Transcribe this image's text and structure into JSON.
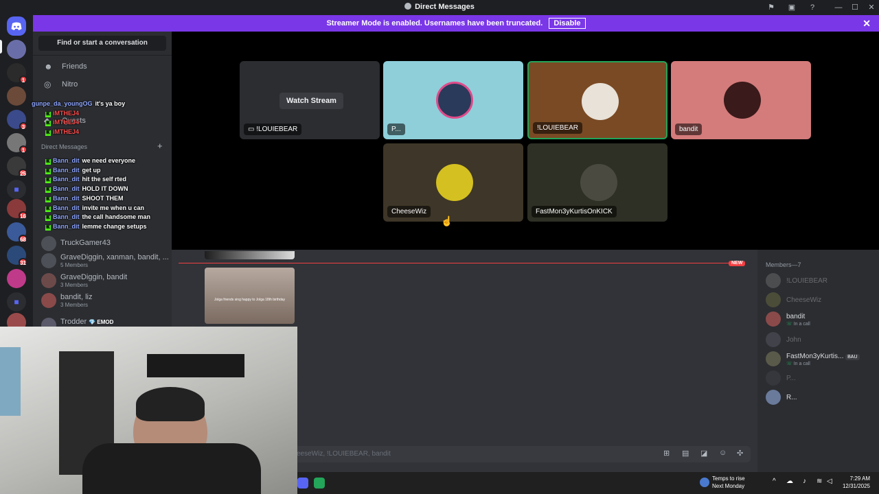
{
  "window": {
    "title": "Direct Messages"
  },
  "banner": {
    "text": "Streamer Mode is enabled. Usernames have been truncated.",
    "disable_label": "Disable"
  },
  "guilds": {
    "badges": [
      "1",
      "3",
      "1",
      "25",
      "16",
      "68",
      "31"
    ]
  },
  "sidebar": {
    "find_placeholder": "Find or start a conversation",
    "nav": [
      {
        "label": "Friends"
      },
      {
        "label": "Nitro"
      },
      {
        "label": "Quests"
      }
    ],
    "section_label": "Direct Messages",
    "dms": [
      {
        "name": "GraveDiggin, xanman, bandit, ...",
        "sub": "5 Members"
      },
      {
        "name": "GraveDiggin, bandit",
        "sub": "3 Members"
      },
      {
        "name": "bandit, liz",
        "sub": "3 Members"
      },
      {
        "name": "Trodder",
        "tag": "EMOD"
      },
      {
        "name": "TruckGamer43"
      }
    ]
  },
  "overlay_chat": [
    {
      "user": "gunpe_da_youngOG",
      "msg": "it's ya boy"
    },
    {
      "user": "iMTHEJ4",
      "msg": ""
    },
    {
      "user": "iMTHEJ4",
      "msg": ""
    },
    {
      "user": "iMTHEJ4",
      "msg": ""
    },
    {
      "user": "Bann_dit",
      "msg": "we need everyone"
    },
    {
      "user": "Bann_dit",
      "msg": "get up"
    },
    {
      "user": "Bann_dit",
      "msg": "hit the self rted"
    },
    {
      "user": "Bann_dit",
      "msg": "HOLD IT DOWN"
    },
    {
      "user": "Bann_dit",
      "msg": "SHOOT THEM"
    },
    {
      "user": "Bann_dit",
      "msg": "invite me when u can"
    },
    {
      "user": "Bann_dit",
      "msg": "the call handsome man"
    },
    {
      "user": "Bann_dit",
      "msg": "lemme change setups"
    }
  ],
  "call": {
    "watch_label": "Watch Stream",
    "tiles": [
      {
        "label": "!LOUIEBEAR",
        "bg": "#2b2d31",
        "stream": true
      },
      {
        "label": "P...",
        "bg": "#8ecfda"
      },
      {
        "label": "!LOUIEBEAR",
        "bg": "#7a4a24",
        "speaking": true
      },
      {
        "label": "bandit",
        "bg": "#d47b7b"
      },
      {
        "label": "CheeseWiz",
        "bg": "#3e3628"
      },
      {
        "label": "FastMon3yKurtisOnKICK",
        "bg": "#2f3025"
      }
    ]
  },
  "chat": {
    "new_label": "NEW",
    "embed_caption": "Jolga friends sing happy to Jolga 18th birthday",
    "input_placeholder": "eeseWiz, !LOUIEBEAR, bandit"
  },
  "members": {
    "header": "Members—7",
    "list": [
      {
        "name": "!LOUIEBEAR",
        "dim": true
      },
      {
        "name": "CheeseWiz",
        "dim": true
      },
      {
        "name": "bandit",
        "status": "In a call"
      },
      {
        "name": "John",
        "dim": true
      },
      {
        "name": "FastMon3yKurtis...",
        "status": "In a call",
        "tag": "BAU"
      },
      {
        "name": "P...",
        "dim": true
      },
      {
        "name": "R..."
      }
    ]
  },
  "taskbar": {
    "weather_title": "Temps to rise",
    "weather_sub": "Next Monday",
    "time": "7:29 AM",
    "date": "12/31/2025"
  },
  "colors": {
    "accent": "#7a37e8",
    "green": "#23a55a",
    "red": "#f23f43"
  }
}
